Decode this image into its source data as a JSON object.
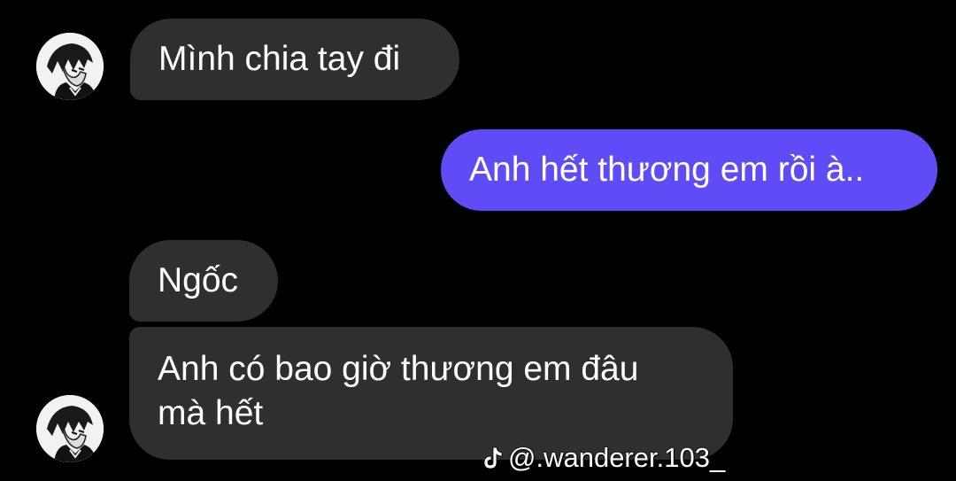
{
  "conversation": {
    "messages": [
      {
        "side": "incoming",
        "text": "Mình chia tay đi"
      },
      {
        "side": "outgoing",
        "text": "Anh hết thương em rồi à.."
      },
      {
        "side": "incoming",
        "text": "Ngốc"
      },
      {
        "side": "incoming",
        "line1": "Anh có bao giờ thương em đâu",
        "line2": "mà hết"
      }
    ]
  },
  "watermark": {
    "icon": "tiktok-icon",
    "handle": "@.wanderer.103_"
  },
  "colors": {
    "background": "#000000",
    "incoming_bubble": "#2f2f2f",
    "outgoing_bubble": "#5f4cf6",
    "text": "#ffffff"
  }
}
